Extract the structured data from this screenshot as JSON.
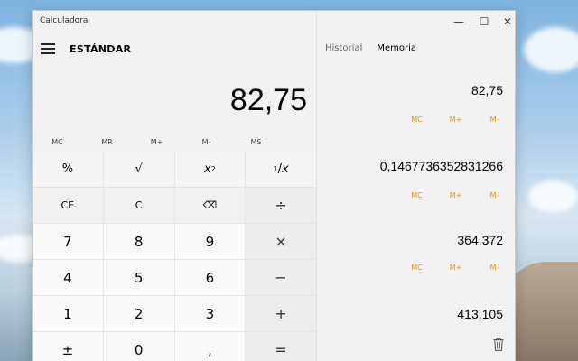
{
  "window": {
    "title": "Calculadora",
    "controls": {
      "minimize": "—",
      "maximize": "☐",
      "close": "✕"
    }
  },
  "header": {
    "mode": "ESTÁNDAR"
  },
  "display": {
    "value": "82,75"
  },
  "memory_bar": [
    "MC",
    "MR",
    "M+",
    "M-",
    "MS"
  ],
  "keys": {
    "row1": {
      "percent": "%",
      "sqrt": "√",
      "square_base": "x",
      "square_exp": "2",
      "recip_num": "1",
      "recip_den": "x"
    },
    "row2": {
      "ce": "CE",
      "c": "C",
      "backspace": "⌫",
      "divide": "÷"
    },
    "row3": {
      "seven": "7",
      "eight": "8",
      "nine": "9",
      "multiply": "×"
    },
    "row4": {
      "four": "4",
      "five": "5",
      "six": "6",
      "minus": "−"
    },
    "row5": {
      "one": "1",
      "two": "2",
      "three": "3",
      "plus": "+"
    },
    "row6": {
      "negate": "±",
      "zero": "0",
      "decimal": ",",
      "equals": "="
    }
  },
  "panel": {
    "tabs": [
      {
        "label": "Historial"
      },
      {
        "label": "Memoria"
      }
    ],
    "memory_items": [
      {
        "value": "82,75",
        "actions": [
          "MC",
          "M+",
          "M-"
        ]
      },
      {
        "value": "0,1467736352831266",
        "actions": [
          "MC",
          "M+",
          "M-"
        ]
      },
      {
        "value": "364.372",
        "actions": [
          "MC",
          "M+",
          "M-"
        ]
      },
      {
        "value": "413.105"
      }
    ]
  },
  "colors": {
    "accent": "#e8920c"
  }
}
